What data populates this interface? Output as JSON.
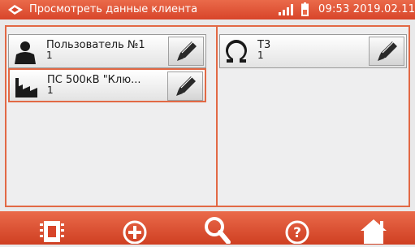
{
  "header": {
    "title": "Просмотреть данные клиента",
    "time": "09:53 2019.02.11",
    "logo_icon": "sonel-logo-icon",
    "signal_icon": "signal-strength-icon",
    "battery_icon": "battery-icon"
  },
  "left_panel": {
    "items": [
      {
        "label": "Пользователь №1",
        "sub": "1",
        "icon": "user-icon",
        "selected": false
      },
      {
        "label": "ПС 500кВ \"Клю...",
        "sub": "1",
        "icon": "factory-icon",
        "selected": true
      }
    ]
  },
  "right_panel": {
    "items": [
      {
        "label": "Т3",
        "sub": "1",
        "icon": "ohm-icon",
        "selected": false
      }
    ]
  },
  "bottom_bar": {
    "buttons": [
      "memory-icon",
      "add-icon",
      "search-icon",
      "help-icon",
      "home-icon"
    ]
  },
  "colors": {
    "accent": "#e26945",
    "header_bg": "#d8452a",
    "panel_bg": "#eeeeef"
  }
}
